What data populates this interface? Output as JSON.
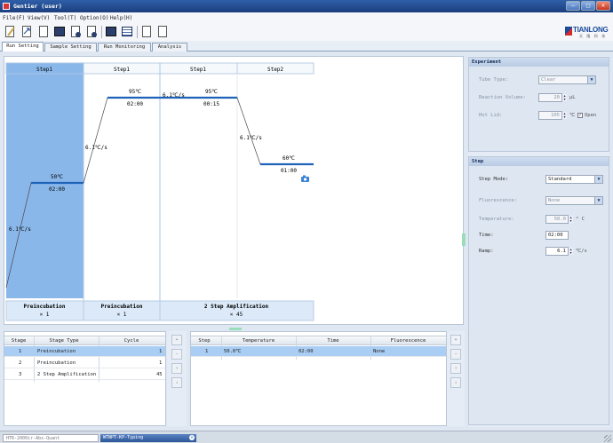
{
  "window": {
    "title": "Gentier (user)",
    "min": "—",
    "max": "□",
    "close": "✕"
  },
  "menu": [
    {
      "label": "File(F)"
    },
    {
      "label": "View(V)"
    },
    {
      "label": "Tool(T)"
    },
    {
      "label": "Option(O)"
    },
    {
      "label": "Help(H)"
    }
  ],
  "logo": {
    "text": "TIANLONG",
    "sub": "天 隆 科 技"
  },
  "tabs": [
    {
      "label": "Run Setting",
      "active": true
    },
    {
      "label": "Sample Setting"
    },
    {
      "label": "Run Monitoring"
    },
    {
      "label": "Analysis"
    }
  ],
  "protocol": {
    "steps": [
      {
        "header": "Step1",
        "temp": "50℃",
        "time": "02:00",
        "ramp_in": "6.1℃/s",
        "selected": true
      },
      {
        "header": "Step1",
        "temp": "95℃",
        "time": "02:00",
        "ramp_in": "6.1℃/s"
      },
      {
        "header": "Step1",
        "temp": "95℃",
        "time": "00:15",
        "ramp_in": "6.1℃/s"
      },
      {
        "header": "Step2",
        "temp": "60℃",
        "time": "01:00",
        "ramp_in": "6.1℃/s"
      }
    ],
    "stages": [
      {
        "name": "Preincubation",
        "cycles": "× 1"
      },
      {
        "name": "Preincubation",
        "cycles": "× 1"
      },
      {
        "name": "2 Step Amplification",
        "cycles": "× 45"
      }
    ]
  },
  "experiment": {
    "title": "Experiment",
    "tube_type_label": "Tube Type:",
    "tube_type_value": "Clear",
    "reaction_volume_label": "Reaction Volume:",
    "reaction_volume_value": "20",
    "reaction_volume_unit": "μL",
    "hot_lid_label": "Hot Lid:",
    "hot_lid_value": "105",
    "hot_lid_unit": "℃",
    "open_label": "Open",
    "open_checked": true
  },
  "step": {
    "title": "Step",
    "step_mode_label": "Step Mode:",
    "step_mode_value": "Standard",
    "fluorescence_label": "Fluorescence:",
    "fluorescence_value": "None",
    "temperature_label": "Temperature:",
    "temperature_value": "50.0",
    "temperature_unit": "° C",
    "time_label": "Time:",
    "time_value": "02:00",
    "ramp_label": "Ramp:",
    "ramp_value": "6.1",
    "ramp_unit": "℃/s"
  },
  "stage_table": {
    "columns": [
      "Stage",
      "Stage Type",
      "Cycle"
    ],
    "rows": [
      {
        "stage": "1",
        "type": "Preincubation",
        "cycle": "1"
      },
      {
        "stage": "2",
        "type": "Preincubation",
        "cycle": "1"
      },
      {
        "stage": "3",
        "type": "2 Step Amplification",
        "cycle": "45"
      }
    ]
  },
  "step_table": {
    "columns": [
      "Step",
      "Temperature",
      "Time",
      "Fluorescence"
    ],
    "rows": [
      {
        "step": "1",
        "temperature": "50.0℃",
        "time": "02:00",
        "fluorescence": "None"
      }
    ]
  },
  "side_buttons": [
    "+",
    "−",
    "↑",
    "↓"
  ],
  "statusbar": {
    "task_a": "HTR-2000ir-Abs-Quant",
    "task_b": "WTNPT-KP-Typing",
    "close": "✕"
  }
}
